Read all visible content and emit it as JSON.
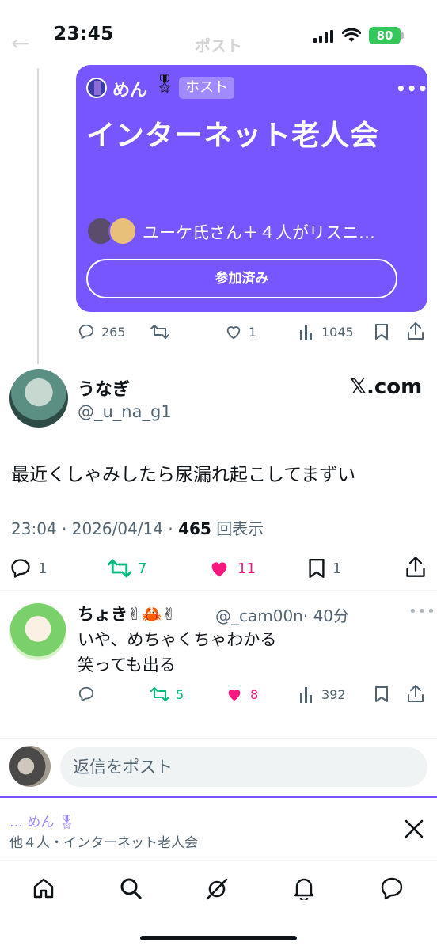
{
  "status_bar": {
    "time": "23:45",
    "battery": "80"
  },
  "header": {
    "back_glyph": "←",
    "title": "ポスト"
  },
  "space_card": {
    "host_name": "めん",
    "host_medal": "🎖",
    "host_badge": "ホスト",
    "title": "インターネット老人会",
    "listeners_text": "ユーケ氏さん＋４人がリスニ…",
    "joined_label": "参加済み",
    "bg_color": "#7856ff"
  },
  "parent_actions": {
    "replies": "265",
    "views": "1045",
    "likes": "1"
  },
  "main_tweet": {
    "display_name": "うなぎ",
    "handle": "@_u_na_g1",
    "watermark": "𝕏.com",
    "text": "最近くしゃみしたら尿漏れ起こしてまずい",
    "time": "23:04",
    "date": "2026/04/14",
    "views": "465",
    "views_label": "回表示",
    "replies": "1",
    "reposts": "7",
    "likes": "11",
    "bookmarks": "1"
  },
  "reply": {
    "display_name": "ちょき✌🦀✌",
    "handle": "@_cam00n",
    "time": "· 40分",
    "line1": "いや、めちゃくちゃわかる",
    "line2": "笑っても出る",
    "replies": "",
    "reposts": "5",
    "likes": "8",
    "views": "392"
  },
  "compose": {
    "placeholder": "返信をポスト"
  },
  "space_bar": {
    "host": "… めん 🎖",
    "title": "他４人・インターネット老人会"
  },
  "colors": {
    "accent": "#7856ff",
    "like": "#f91880",
    "repost": "#00ba7c",
    "muted": "#536471"
  },
  "tabs": [
    "home-icon",
    "search-icon",
    "grok-icon",
    "notifications-icon",
    "messages-icon"
  ]
}
